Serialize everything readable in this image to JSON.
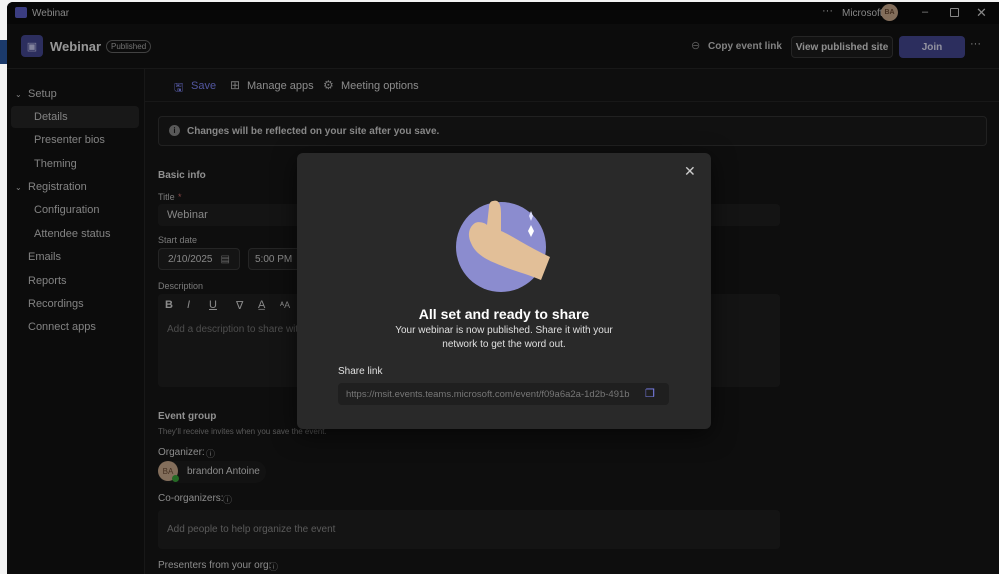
{
  "window": {
    "title": "Webinar",
    "account": "Microsoft",
    "avatar_initials": "BA"
  },
  "header": {
    "title": "Webinar",
    "status_badge": "Published",
    "copy_link": "Copy event link",
    "view_site": "View published site",
    "join": "Join"
  },
  "sidebar": {
    "items": [
      {
        "label": "Setup",
        "type": "group"
      },
      {
        "label": "Details",
        "type": "child",
        "selected": true
      },
      {
        "label": "Presenter bios",
        "type": "child"
      },
      {
        "label": "Theming",
        "type": "child"
      },
      {
        "label": "Registration",
        "type": "group"
      },
      {
        "label": "Configuration",
        "type": "child"
      },
      {
        "label": "Attendee status",
        "type": "child"
      },
      {
        "label": "Emails",
        "type": "top"
      },
      {
        "label": "Reports",
        "type": "top"
      },
      {
        "label": "Recordings",
        "type": "top"
      },
      {
        "label": "Connect apps",
        "type": "top"
      }
    ]
  },
  "toolbar": {
    "save": "Save",
    "manage_apps": "Manage apps",
    "meeting_options": "Meeting options"
  },
  "banner": "Changes will be reflected on your site after you save.",
  "form": {
    "basic_info": "Basic info",
    "title_label": "Title",
    "required_mark": "*",
    "title_value": "Webinar",
    "start_date_label": "Start date",
    "start_date": "2/10/2025",
    "start_time": "5:00 PM",
    "description_label": "Description",
    "description_placeholder": "Add a description to share with",
    "event_group": "Event group",
    "event_group_sub": "They'll receive invites when you save the event.",
    "organizer_label": "Organizer:",
    "organizer_name": "brandon Antoine",
    "organizer_initials": "BA",
    "coorganizers_label": "Co-organizers:",
    "coorganizers_placeholder": "Add people to help organize the event",
    "presenters_label": "Presenters from your org:"
  },
  "modal": {
    "title": "All set and ready to share",
    "body_line1": "Your webinar is now published. Share it with your",
    "body_line2": "network to get the word out.",
    "share_label": "Share link",
    "share_url": "https://msit.events.teams.microsoft.com/event/f09a6a2a-1d2b-491b"
  },
  "colors": {
    "accent": "#444791",
    "accent_text": "#7f85f5",
    "modal_bg": "#292929",
    "illustration": "#8b8ccf",
    "skin": "#e2bf98"
  }
}
